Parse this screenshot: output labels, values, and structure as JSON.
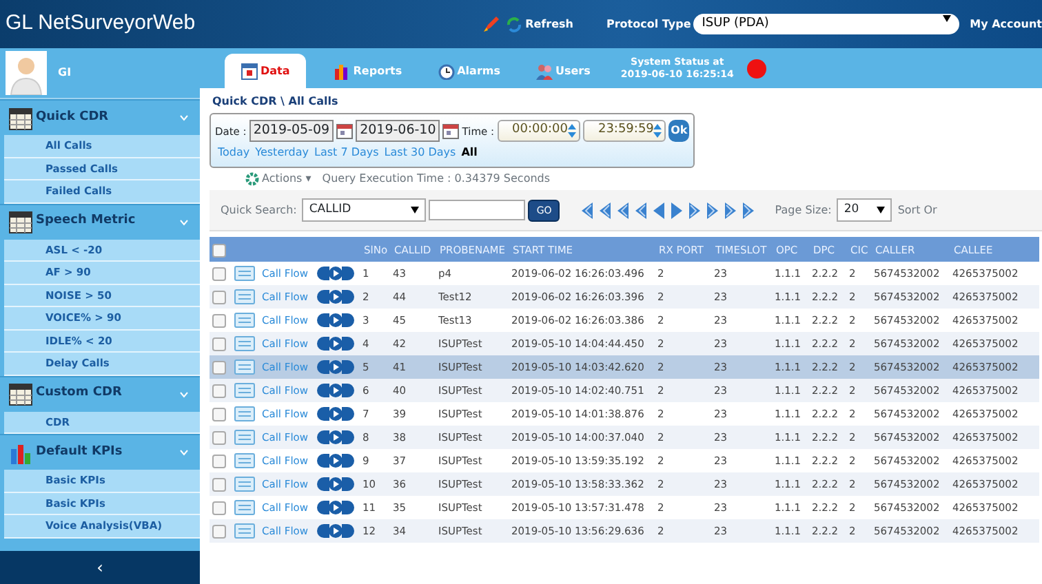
{
  "header": {
    "logo": "GL NetSurveyorWeb",
    "refresh_label": "Refresh",
    "protocol_label": "Protocol Type",
    "protocol_value": "ISUP (PDA)",
    "account_label": "My Account"
  },
  "user": {
    "name": "GI"
  },
  "sidebar": {
    "collapse_label": "‹",
    "sections": [
      {
        "title": "Quick CDR",
        "kind": "table",
        "expanded": true,
        "items": [
          "All Calls",
          "Passed Calls",
          "Failed Calls"
        ]
      },
      {
        "title": "Speech Metric",
        "kind": "table",
        "expanded": true,
        "items": [
          "ASL < -20",
          "AF > 90",
          "NOISE > 50",
          "VOICE% > 90",
          "IDLE% < 20",
          "Delay Calls"
        ]
      },
      {
        "title": "Custom CDR",
        "kind": "table",
        "expanded": true,
        "items": [
          "CDR"
        ]
      },
      {
        "title": "Default KPIs",
        "kind": "chart",
        "expanded": true,
        "items": [
          "Basic KPIs",
          "Basic KPIs",
          "Voice Analysis(VBA)"
        ]
      }
    ]
  },
  "tabs": [
    {
      "label": "Data",
      "kind": "calendar",
      "selected": true
    },
    {
      "label": "Reports",
      "kind": "bars",
      "selected": false
    },
    {
      "label": "Alarms",
      "kind": "clock",
      "selected": false
    },
    {
      "label": "Users",
      "kind": "people",
      "selected": false
    }
  ],
  "system_status": {
    "line_1": "System Status at",
    "line_2": "2019-06-10 16:25:14",
    "color": "#ee1111"
  },
  "breadcrumb": "Quick CDR \\ All Calls",
  "date_filter": {
    "date_label": "Date :",
    "from": "2019-05-09",
    "to": "2019-06-10",
    "time_label": "Time :",
    "time_from": "00:00:00",
    "time_to": "23:59:59",
    "ok_label": "Ok",
    "quick_ranges": [
      {
        "label": "Today",
        "selected": false
      },
      {
        "label": "Yesterday",
        "selected": false
      },
      {
        "label": "Last 7 Days",
        "selected": false
      },
      {
        "label": "Last 30 Days",
        "selected": false
      },
      {
        "label": "All",
        "selected": true
      }
    ]
  },
  "actions_label": "Actions ▾",
  "query_time": "Query Execution Time : 0.34379 Seconds",
  "quick_search": {
    "label": "Quick Search:",
    "field": "CALLID",
    "go_label": "GO",
    "page_size_label": "Page Size:",
    "page_size": "20",
    "sort_label": "Sort Or"
  },
  "table": {
    "header_checked": false,
    "columns": [
      "SlNo",
      "CALLID",
      "PROBENAME",
      "START TIME",
      "RX PORT",
      "TIMESLOT",
      "OPC",
      "DPC",
      "CIC",
      "CALLER",
      "CALLEE"
    ],
    "rows": [
      {
        "selected": false,
        "checked": false,
        "link": "Call Flow",
        "cells": [
          "1",
          "43",
          "p4",
          "2019-06-02 16:26:03.496",
          "2",
          "23",
          "1.1.1",
          "2.2.2",
          "2",
          "5674532002",
          "4265375002"
        ]
      },
      {
        "selected": false,
        "checked": false,
        "link": "Call Flow",
        "cells": [
          "2",
          "44",
          "Test12",
          "2019-06-02 16:26:03.396",
          "2",
          "23",
          "1.1.1",
          "2.2.2",
          "2",
          "5674532002",
          "4265375002"
        ]
      },
      {
        "selected": false,
        "checked": false,
        "link": "Call Flow",
        "cells": [
          "3",
          "45",
          "Test13",
          "2019-06-02 16:26:03.386",
          "2",
          "23",
          "1.1.1",
          "2.2.2",
          "2",
          "5674532002",
          "4265375002"
        ]
      },
      {
        "selected": false,
        "checked": false,
        "link": "Call Flow",
        "cells": [
          "4",
          "42",
          "ISUPTest",
          "2019-05-10 14:04:44.450",
          "2",
          "23",
          "1.1.1",
          "2.2.2",
          "2",
          "5674532002",
          "4265375002"
        ]
      },
      {
        "selected": true,
        "checked": false,
        "link": "Call Flow",
        "cells": [
          "5",
          "41",
          "ISUPTest",
          "2019-05-10 14:03:42.620",
          "2",
          "23",
          "1.1.1",
          "2.2.2",
          "2",
          "5674532002",
          "4265375002"
        ]
      },
      {
        "selected": false,
        "checked": false,
        "link": "Call Flow",
        "cells": [
          "6",
          "40",
          "ISUPTest",
          "2019-05-10 14:02:40.751",
          "2",
          "23",
          "1.1.1",
          "2.2.2",
          "2",
          "5674532002",
          "4265375002"
        ]
      },
      {
        "selected": false,
        "checked": false,
        "link": "Call Flow",
        "cells": [
          "7",
          "39",
          "ISUPTest",
          "2019-05-10 14:01:38.876",
          "2",
          "23",
          "1.1.1",
          "2.2.2",
          "2",
          "5674532002",
          "4265375002"
        ]
      },
      {
        "selected": false,
        "checked": false,
        "link": "Call Flow",
        "cells": [
          "8",
          "38",
          "ISUPTest",
          "2019-05-10 14:00:37.040",
          "2",
          "23",
          "1.1.1",
          "2.2.2",
          "2",
          "5674532002",
          "4265375002"
        ]
      },
      {
        "selected": false,
        "checked": false,
        "link": "Call Flow",
        "cells": [
          "9",
          "37",
          "ISUPTest",
          "2019-05-10 13:59:35.192",
          "2",
          "23",
          "1.1.1",
          "2.2.2",
          "2",
          "5674532002",
          "4265375002"
        ]
      },
      {
        "selected": false,
        "checked": false,
        "link": "Call Flow",
        "cells": [
          "10",
          "36",
          "ISUPTest",
          "2019-05-10 13:58:33.362",
          "2",
          "23",
          "1.1.1",
          "2.2.2",
          "2",
          "5674532002",
          "4265375002"
        ]
      },
      {
        "selected": false,
        "checked": false,
        "link": "Call Flow",
        "cells": [
          "11",
          "35",
          "ISUPTest",
          "2019-05-10 13:57:31.478",
          "2",
          "23",
          "1.1.1",
          "2.2.2",
          "2",
          "5674532002",
          "4265375002"
        ]
      },
      {
        "selected": false,
        "checked": false,
        "link": "Call Flow",
        "cells": [
          "12",
          "34",
          "ISUPTest",
          "2019-05-10 13:56:29.636",
          "2",
          "23",
          "1.1.1",
          "2.2.2",
          "2",
          "5674532002",
          "4265375002"
        ]
      }
    ]
  }
}
